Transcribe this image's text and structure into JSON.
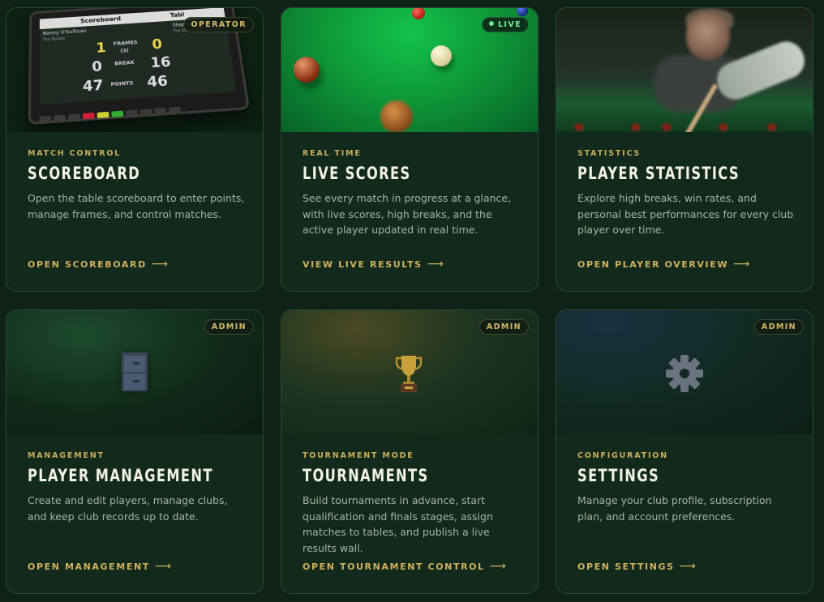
{
  "cards": [
    {
      "eyebrow": "MATCH CONTROL",
      "title": "SCOREBOARD",
      "description": "Open the table scoreboard to enter points, manage frames, and control matches.",
      "cta": "OPEN SCOREBOARD",
      "badge": "OPERATOR",
      "media": {
        "header_left": "Scoreboard",
        "header_right": "Tabl",
        "player1_name": "Ronny O'Sullivan",
        "player1_nick": "The Rocket",
        "player2_name": "Stephen",
        "player2_nick": "The King of the Crucible",
        "frames_label": "FRAMES",
        "frames_total": "(3)",
        "break_label": "BREAK",
        "points_label": "POINTS",
        "p1_frames": "1",
        "p1_break": "0",
        "p1_points": "47",
        "p2_frames": "0",
        "p2_break": "16",
        "p2_points": "46"
      }
    },
    {
      "eyebrow": "REAL TIME",
      "title": "LIVE SCORES",
      "description": "See every match in progress at a glance, with live scores, high breaks, and the active player updated in real time.",
      "cta": "VIEW LIVE RESULTS",
      "badge": "LIVE"
    },
    {
      "eyebrow": "STATISTICS",
      "title": "PLAYER STATISTICS",
      "description": "Explore high breaks, win rates, and personal best performances for every club player over time.",
      "cta": "OPEN PLAYER OVERVIEW"
    },
    {
      "eyebrow": "MANAGEMENT",
      "title": "PLAYER MANAGEMENT",
      "description": "Create and edit players, manage clubs, and keep club records up to date.",
      "cta": "OPEN MANAGEMENT",
      "badge": "ADMIN"
    },
    {
      "eyebrow": "TOURNAMENT MODE",
      "title": "TOURNAMENTS",
      "description": "Build tournaments in advance, start qualification and finals stages, assign matches to tables, and publish a live results wall.",
      "cta": "OPEN TOURNAMENT CONTROL",
      "badge": "ADMIN"
    },
    {
      "eyebrow": "CONFIGURATION",
      "title": "SETTINGS",
      "description": "Manage your club profile, subscription plan, and account preferences.",
      "cta": "OPEN SETTINGS",
      "badge": "ADMIN"
    }
  ],
  "icons": {
    "card1": "scoreboard-tablet-image",
    "card2": "snooker-table-image",
    "card3": "player-photo-image",
    "card4": "filing-cabinet-icon",
    "card5": "trophy-icon",
    "card6": "gear-icon",
    "cta_arrow": "arrow-right-icon"
  },
  "colors": {
    "page_bg": "#0e2217",
    "card_bg": "#112a1c",
    "accent_gold": "#cfb15d",
    "live_green": "#6fe08e"
  }
}
